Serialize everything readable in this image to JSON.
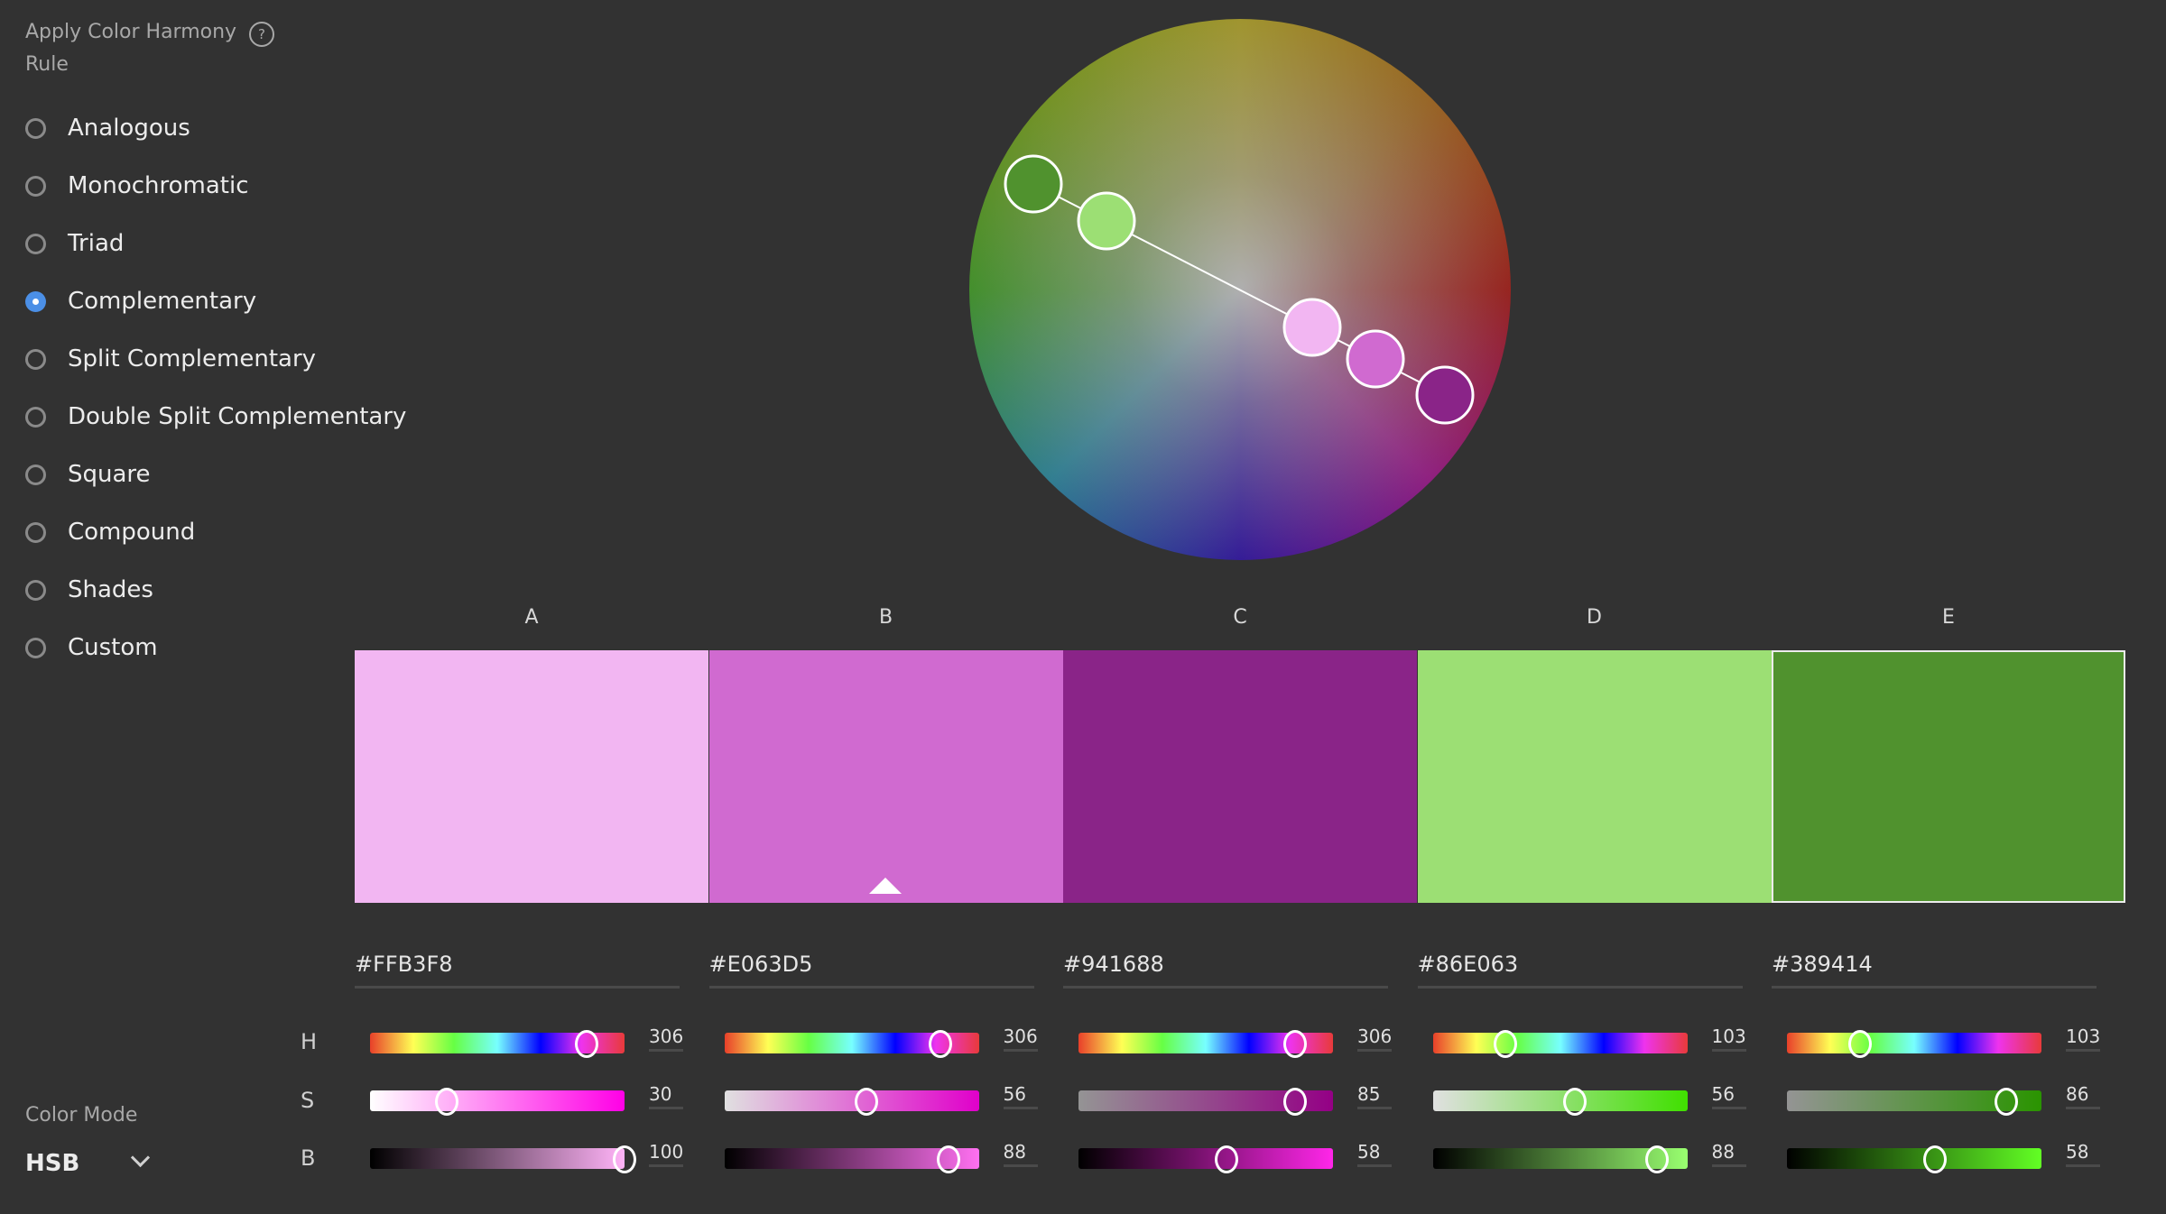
{
  "harmony": {
    "title": "Apply Color Harmony Rule",
    "help_icon": "question-circle-icon",
    "rules": [
      {
        "label": "Analogous",
        "selected": false
      },
      {
        "label": "Monochromatic",
        "selected": false
      },
      {
        "label": "Triad",
        "selected": false
      },
      {
        "label": "Complementary",
        "selected": true
      },
      {
        "label": "Split Complementary",
        "selected": false
      },
      {
        "label": "Double Split Complementary",
        "selected": false
      },
      {
        "label": "Square",
        "selected": false
      },
      {
        "label": "Compound",
        "selected": false
      },
      {
        "label": "Shades",
        "selected": false
      },
      {
        "label": "Custom",
        "selected": false
      }
    ]
  },
  "swatches": [
    {
      "label": "A",
      "hex": "#FFB3F8",
      "color": "#F2B6F2",
      "h": 306,
      "s": 30,
      "b": 100
    },
    {
      "label": "B",
      "hex": "#E063D5",
      "color": "#D06AD0",
      "h": 306,
      "s": 56,
      "b": 88,
      "base": true
    },
    {
      "label": "C",
      "hex": "#941688",
      "color": "#8A2488",
      "h": 306,
      "s": 85,
      "b": 58
    },
    {
      "label": "D",
      "hex": "#86E063",
      "color": "#9CDF74",
      "h": 103,
      "s": 56,
      "b": 88
    },
    {
      "label": "E",
      "hex": "#389414",
      "color": "#50922E",
      "h": 103,
      "s": 86,
      "b": 58,
      "selected": true
    }
  ],
  "channel_labels": [
    "H",
    "S",
    "B"
  ],
  "color_mode": {
    "label": "Color Mode",
    "value": "HSB"
  }
}
